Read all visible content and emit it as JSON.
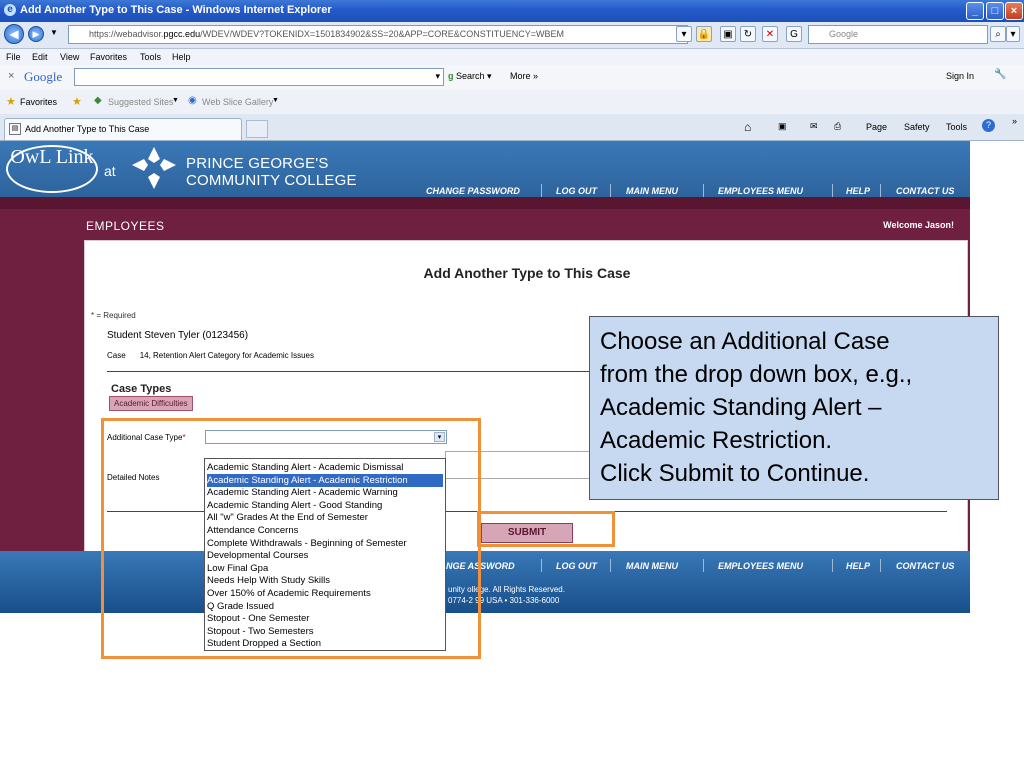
{
  "window": {
    "title": "Add Another Type to This Case - Windows Internet Explorer"
  },
  "address_bar": {
    "url_prefix": "https://webadvisor.",
    "url_domain": "pgcc.edu",
    "url_rest": "/WDEV/WDEV?TOKENIDX=1501834902&SS=20&APP=CORE&CONSTITUENCY=WBEM",
    "search_placeholder": "Google"
  },
  "menu": [
    "File",
    "Edit",
    "View",
    "Favorites",
    "Tools",
    "Help"
  ],
  "google_toolbar": {
    "close": "×",
    "logo": "Google",
    "search_label": "Search",
    "more_label": "More »",
    "sign_in": "Sign In"
  },
  "favorites_bar": {
    "favorites": "Favorites",
    "suggested": "Suggested Sites",
    "slice": "Web Slice Gallery"
  },
  "tab": {
    "label": "Add Another Type to This Case",
    "right_tools": [
      "Page",
      "Safety",
      "Tools"
    ]
  },
  "site": {
    "logo_text": "OwL Link",
    "at": "at",
    "college_line1": "PRINCE GEORGE'S",
    "college_line2": "COMMUNITY COLLEGE",
    "nav": [
      "CHANGE PASSWORD",
      "LOG OUT",
      "MAIN MENU",
      "EMPLOYEES MENU",
      "HELP",
      "CONTACT US"
    ],
    "section_title": "EMPLOYEES",
    "welcome": "Welcome Jason!"
  },
  "form": {
    "title": "Add Another Type to This Case",
    "required_note": "* = Required",
    "student": "Student Steven Tyler (0123456)",
    "case_label": "Case",
    "case_value": "14, Retention Alert Category for Academic Issues",
    "case_types_heading": "Case Types",
    "case_type_badge": "Academic Difficulties",
    "additional_label": "Additional Case Type",
    "required_star": "*",
    "notes_label": "Detailed Notes",
    "submit": "SUBMIT",
    "dropdown_arrow": "▾",
    "options": [
      "Academic Standing Alert - Academic Dismissal",
      "Academic Standing Alert - Academic Restriction",
      "Academic Standing Alert - Academic Warning",
      "Academic Standing Alert - Good Standing",
      "All \"w\" Grades At the End of Semester",
      "Attendance Concerns",
      "Complete Withdrawals - Beginning of Semester",
      "Developmental Courses",
      "Low Final Gpa",
      "Needs Help With Study Skills",
      "Over 150% of Academic Requirements",
      "Q Grade Issued",
      "Stopout - One Semester",
      "Stopout - Two Semesters",
      "Student Dropped a Section"
    ],
    "selected_option": "Academic Standing Alert - Academic Restriction"
  },
  "footer": {
    "nav_partial": [
      "NGE  ASSWORD",
      "LOG OUT",
      "MAIN MENU",
      "EMPLOYEES MENU",
      "HELP",
      "CONTACT US"
    ],
    "copyright_line1": "unity  ollege. All Rights Reserved.",
    "copyright_line2": "0774-2  99 USA • 301-336-6000"
  },
  "callout": {
    "lines": [
      "Choose an Additional Case",
      "from the drop down box, e.g.,",
      "Academic Standing Alert –",
      "Academic Restriction.",
      "Click Submit to Continue."
    ]
  },
  "colors": {
    "header_blue": "#2b5f97",
    "maroon": "#6f1f3f",
    "highlight_orange": "#f0913a",
    "callout_bg": "#c6d9f1",
    "selected_option_bg": "#316ac5"
  }
}
